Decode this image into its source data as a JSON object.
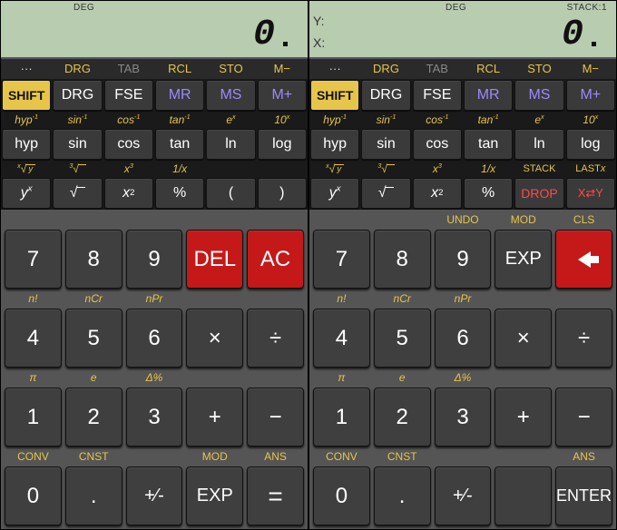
{
  "left": {
    "lcd": {
      "deg": "DEG",
      "value": "0"
    },
    "toprow": [
      "···",
      "DRG",
      "TAB",
      "RCL",
      "STO",
      "M−"
    ],
    "funcrow1": [
      "SHIFT",
      "DRG",
      "FSE",
      "MR",
      "MS",
      "M+"
    ],
    "labels2": [
      "hyp⁻¹",
      "sin⁻¹",
      "cos⁻¹",
      "tan⁻¹",
      "eˣ",
      "10ˣ"
    ],
    "funcrow2": [
      "hyp",
      "sin",
      "cos",
      "tan",
      "ln",
      "log"
    ],
    "labels3": [
      "ˣ√y",
      "³√",
      "x³",
      "1/x",
      "",
      ""
    ],
    "funcrow3": [
      "yˣ",
      "√",
      "x²",
      "%",
      "(",
      ")"
    ],
    "numpad": {
      "r1_labels": [
        "",
        "",
        "",
        "",
        ""
      ],
      "r1": [
        "7",
        "8",
        "9",
        "DEL",
        "AC"
      ],
      "r2_labels": [
        "n!",
        "nCr",
        "nPr",
        "",
        ""
      ],
      "r2": [
        "4",
        "5",
        "6",
        "×",
        "÷"
      ],
      "r3_labels": [
        "π",
        "e",
        "Δ%",
        "",
        ""
      ],
      "r3": [
        "1",
        "2",
        "3",
        "+",
        "−"
      ],
      "r4_labels": [
        "CONV",
        "CNST",
        "",
        "MOD",
        "ANS"
      ],
      "r4": [
        "0",
        ".",
        "+/-",
        "EXP",
        "="
      ]
    }
  },
  "right": {
    "lcd": {
      "deg": "DEG",
      "stack": "STACK:1",
      "y_label": "Y:",
      "x_label": "X:",
      "x_value": "0"
    },
    "toprow": [
      "···",
      "DRG",
      "TAB",
      "RCL",
      "STO",
      "M−"
    ],
    "funcrow1": [
      "SHIFT",
      "DRG",
      "FSE",
      "MR",
      "MS",
      "M+"
    ],
    "labels2": [
      "hyp⁻¹",
      "sin⁻¹",
      "cos⁻¹",
      "tan⁻¹",
      "eˣ",
      "10ˣ"
    ],
    "funcrow2": [
      "hyp",
      "sin",
      "cos",
      "tan",
      "ln",
      "log"
    ],
    "labels3": [
      "ˣ√y",
      "³√",
      "x³",
      "1/x",
      "STACK",
      "LASTx"
    ],
    "funcrow3": [
      "yˣ",
      "√",
      "x²",
      "%",
      "DROP",
      "X⇄Y"
    ],
    "numpad": {
      "r1_labels": [
        "",
        "",
        "UNDO",
        "MOD",
        "CLS"
      ],
      "r1": [
        "7",
        "8",
        "9",
        "EXP",
        "←"
      ],
      "r2_labels": [
        "n!",
        "nCr",
        "nPr",
        "",
        ""
      ],
      "r2": [
        "4",
        "5",
        "6",
        "×",
        "÷"
      ],
      "r3_labels": [
        "π",
        "e",
        "Δ%",
        "",
        ""
      ],
      "r3": [
        "1",
        "2",
        "3",
        "+",
        "−"
      ],
      "r4_labels": [
        "CONV",
        "CNST",
        "",
        "",
        "ANS"
      ],
      "r4": [
        "0",
        ".",
        "+/-",
        "",
        "ENTER"
      ]
    }
  }
}
